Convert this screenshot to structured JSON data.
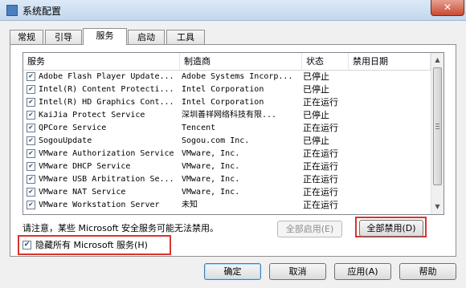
{
  "window": {
    "title": "系统配置",
    "close_glyph": "✕"
  },
  "tabs": [
    {
      "label": "常规",
      "active": false
    },
    {
      "label": "引导",
      "active": false
    },
    {
      "label": "服务",
      "active": true
    },
    {
      "label": "启动",
      "active": false
    },
    {
      "label": "工具",
      "active": false
    }
  ],
  "table": {
    "headers": {
      "service": "服务",
      "maker": "制造商",
      "status": "状态",
      "disabled_date": "禁用日期"
    },
    "rows": [
      {
        "checked": true,
        "service": "Adobe Flash Player Update...",
        "maker": "Adobe Systems Incorp...",
        "status": "已停止",
        "date": ""
      },
      {
        "checked": true,
        "service": "Intel(R) Content Protecti...",
        "maker": "Intel Corporation",
        "status": "已停止",
        "date": ""
      },
      {
        "checked": true,
        "service": "Intel(R) HD Graphics Cont...",
        "maker": "Intel Corporation",
        "status": "正在运行",
        "date": ""
      },
      {
        "checked": true,
        "service": "KaiJia Protect Service",
        "maker": "深圳善祥网络科技有限...",
        "status": "已停止",
        "date": ""
      },
      {
        "checked": true,
        "service": "QPCore Service",
        "maker": "Tencent",
        "status": "正在运行",
        "date": ""
      },
      {
        "checked": true,
        "service": "SogouUpdate",
        "maker": "Sogou.com Inc.",
        "status": "已停止",
        "date": ""
      },
      {
        "checked": true,
        "service": "VMware Authorization Service",
        "maker": "VMware, Inc.",
        "status": "正在运行",
        "date": ""
      },
      {
        "checked": true,
        "service": "VMware DHCP Service",
        "maker": "VMware, Inc.",
        "status": "正在运行",
        "date": ""
      },
      {
        "checked": true,
        "service": "VMware USB Arbitration Se...",
        "maker": "VMware, Inc.",
        "status": "正在运行",
        "date": ""
      },
      {
        "checked": true,
        "service": "VMware NAT Service",
        "maker": "VMware, Inc.",
        "status": "正在运行",
        "date": ""
      },
      {
        "checked": true,
        "service": "VMware Workstation Server",
        "maker": "未知",
        "status": "正在运行",
        "date": ""
      }
    ]
  },
  "notice": "请注意，某些 Microsoft 安全服务可能无法禁用。",
  "enable_all_label": "全部启用(E)",
  "disable_all_label": "全部禁用(D)",
  "hide_ms": {
    "checked": true,
    "label": "隐藏所有 Microsoft 服务(H)"
  },
  "footer": {
    "ok": "确定",
    "cancel": "取消",
    "apply": "应用(A)",
    "help": "帮助"
  },
  "check_glyph": "✔",
  "highlight_color": "#d9342b"
}
